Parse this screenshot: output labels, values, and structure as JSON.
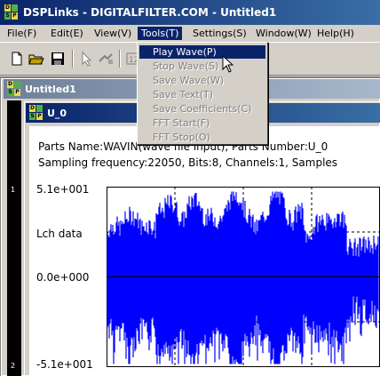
{
  "app": {
    "title": "DSPLinks - DIGITALFILTER.COM - Untitled1"
  },
  "menubar": {
    "items": [
      {
        "label": "File(F)"
      },
      {
        "label": "Edit(E)"
      },
      {
        "label": "View(V)"
      },
      {
        "label": "Tools(T)"
      },
      {
        "label": "Settings(S)"
      },
      {
        "label": "Window(W)"
      },
      {
        "label": "Help(H)"
      }
    ]
  },
  "toolbar": {
    "icons": [
      "new-file-icon",
      "open-folder-icon",
      "save-icon",
      "pointer-icon",
      "connect-icon",
      "filter-icon"
    ]
  },
  "tools_menu": {
    "items": [
      {
        "label": "Play Wave(P)",
        "highlighted": true
      },
      {
        "label": "Stop Wave(S)"
      },
      {
        "label": "Save Wave(W)"
      },
      {
        "label": "Save Text(T)"
      },
      {
        "label": "Save Coefficients(C)"
      },
      {
        "label": "FFT Start(F)"
      },
      {
        "label": "FFT Stop(O)"
      }
    ]
  },
  "doc_window": {
    "title": "Untitled1"
  },
  "channel_sidebar": {
    "labels": [
      "1",
      "2"
    ]
  },
  "part_window": {
    "title": "U_0",
    "info_line1": "Parts Name:WAVIN(wave file input), Parts Number:U_0",
    "info_line2": "Sampling frequency:22050, Bits:8, Channels:1, Samples",
    "y_max_label": "5.1e+001",
    "y_mid_label": "0.0e+000",
    "y_min_label": "-5.1e+001",
    "channel_label": "Lch data"
  },
  "colors": {
    "waveform": "#0000ff",
    "title_active": "#0a246a",
    "highlight": "#0a246a"
  }
}
